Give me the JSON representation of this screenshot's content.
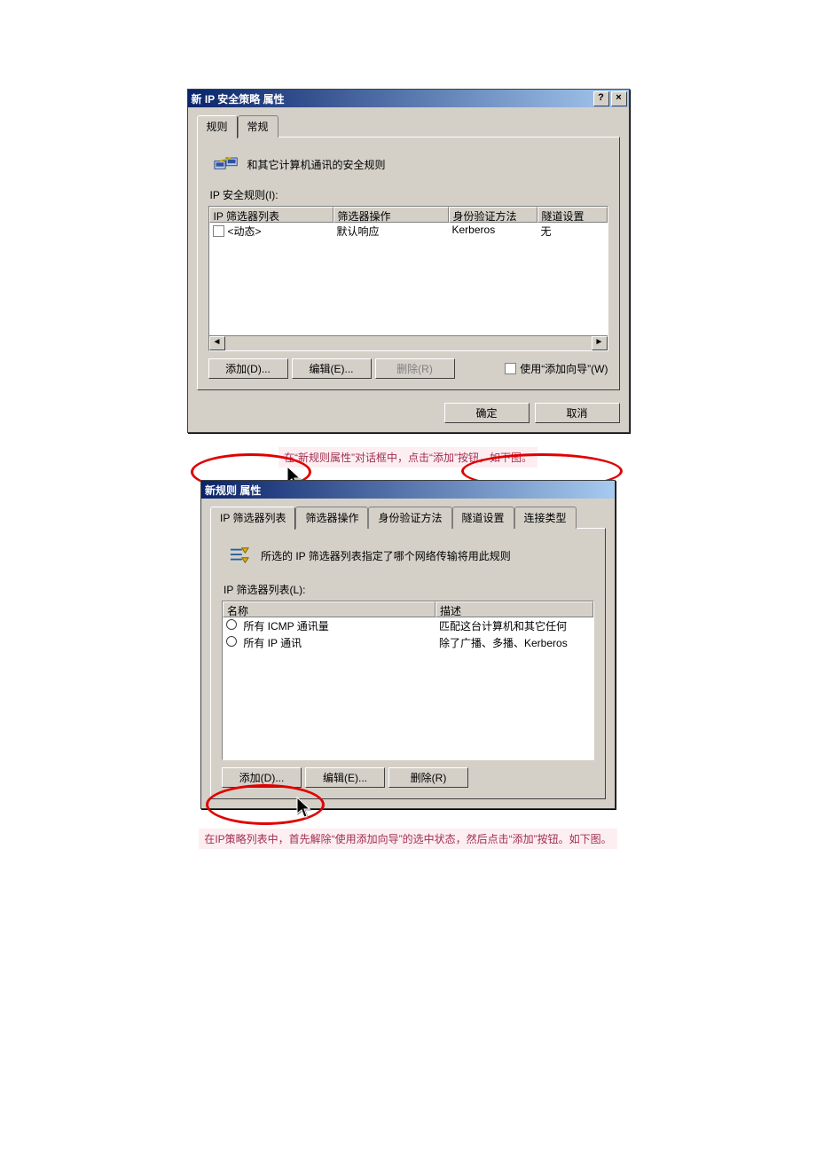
{
  "dialog1": {
    "title": "新 IP 安全策略 属性",
    "helpGlyph": "?",
    "closeGlyph": "×",
    "tabs": {
      "rules": "规则",
      "general": "常规"
    },
    "desc": "和其它计算机通讯的安全规则",
    "rulesLabel": "IP 安全规则(I):",
    "columns": {
      "c1": "IP 筛选器列表",
      "c2": "筛选器操作",
      "c3": "身份验证方法",
      "c4": "隧道设置"
    },
    "row": {
      "c1": "<动态>",
      "c2": "默认响应",
      "c3": "Kerberos",
      "c4": "无"
    },
    "scroll": {
      "left": "◄",
      "right": "►"
    },
    "buttons": {
      "add": "添加(D)...",
      "edit": "编辑(E)...",
      "remove": "删除(R)"
    },
    "wizard": "使用“添加向导”(W)",
    "ok": "确定",
    "cancel": "取消"
  },
  "caption1": "在“新规则属性”对话框中，点击“添加”按钮，如下图。",
  "dialog2": {
    "title": "新规则 属性",
    "tabs": {
      "t1": "IP 筛选器列表",
      "t2": "筛选器操作",
      "t3": "身份验证方法",
      "t4": "隧道设置",
      "t5": "连接类型"
    },
    "desc": "所选的 IP 筛选器列表指定了哪个网络传输将用此规则",
    "listLabel": "IP 筛选器列表(L):",
    "columns": {
      "c1": "名称",
      "c2": "描述"
    },
    "rows": {
      "r1c1": "所有 ICMP 通讯量",
      "r1c2": "匹配这台计算机和其它任何",
      "r2c1": "所有 IP 通讯",
      "r2c2": "除了广播、多播、Kerberos"
    },
    "buttons": {
      "add": "添加(D)...",
      "edit": "编辑(E)...",
      "remove": "删除(R)"
    }
  },
  "caption2": "在IP策略列表中，首先解除“使用添加向导”的选中状态，然后点击“添加”按钮。如下图。"
}
